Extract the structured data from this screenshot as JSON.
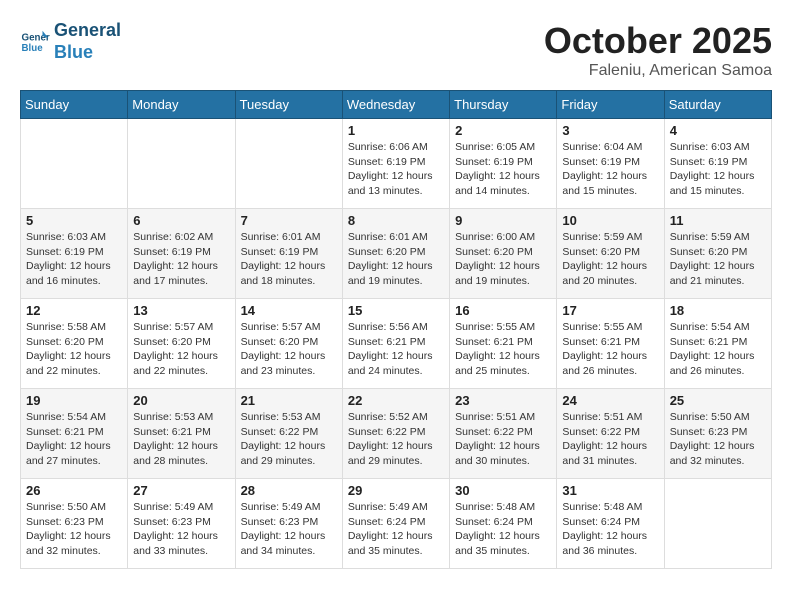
{
  "header": {
    "logo_line1": "General",
    "logo_line2": "Blue",
    "month": "October 2025",
    "location": "Faleniu, American Samoa"
  },
  "weekdays": [
    "Sunday",
    "Monday",
    "Tuesday",
    "Wednesday",
    "Thursday",
    "Friday",
    "Saturday"
  ],
  "weeks": [
    [
      {
        "day": "",
        "info": ""
      },
      {
        "day": "",
        "info": ""
      },
      {
        "day": "",
        "info": ""
      },
      {
        "day": "1",
        "info": "Sunrise: 6:06 AM\nSunset: 6:19 PM\nDaylight: 12 hours\nand 13 minutes."
      },
      {
        "day": "2",
        "info": "Sunrise: 6:05 AM\nSunset: 6:19 PM\nDaylight: 12 hours\nand 14 minutes."
      },
      {
        "day": "3",
        "info": "Sunrise: 6:04 AM\nSunset: 6:19 PM\nDaylight: 12 hours\nand 15 minutes."
      },
      {
        "day": "4",
        "info": "Sunrise: 6:03 AM\nSunset: 6:19 PM\nDaylight: 12 hours\nand 15 minutes."
      }
    ],
    [
      {
        "day": "5",
        "info": "Sunrise: 6:03 AM\nSunset: 6:19 PM\nDaylight: 12 hours\nand 16 minutes."
      },
      {
        "day": "6",
        "info": "Sunrise: 6:02 AM\nSunset: 6:19 PM\nDaylight: 12 hours\nand 17 minutes."
      },
      {
        "day": "7",
        "info": "Sunrise: 6:01 AM\nSunset: 6:19 PM\nDaylight: 12 hours\nand 18 minutes."
      },
      {
        "day": "8",
        "info": "Sunrise: 6:01 AM\nSunset: 6:20 PM\nDaylight: 12 hours\nand 19 minutes."
      },
      {
        "day": "9",
        "info": "Sunrise: 6:00 AM\nSunset: 6:20 PM\nDaylight: 12 hours\nand 19 minutes."
      },
      {
        "day": "10",
        "info": "Sunrise: 5:59 AM\nSunset: 6:20 PM\nDaylight: 12 hours\nand 20 minutes."
      },
      {
        "day": "11",
        "info": "Sunrise: 5:59 AM\nSunset: 6:20 PM\nDaylight: 12 hours\nand 21 minutes."
      }
    ],
    [
      {
        "day": "12",
        "info": "Sunrise: 5:58 AM\nSunset: 6:20 PM\nDaylight: 12 hours\nand 22 minutes."
      },
      {
        "day": "13",
        "info": "Sunrise: 5:57 AM\nSunset: 6:20 PM\nDaylight: 12 hours\nand 22 minutes."
      },
      {
        "day": "14",
        "info": "Sunrise: 5:57 AM\nSunset: 6:20 PM\nDaylight: 12 hours\nand 23 minutes."
      },
      {
        "day": "15",
        "info": "Sunrise: 5:56 AM\nSunset: 6:21 PM\nDaylight: 12 hours\nand 24 minutes."
      },
      {
        "day": "16",
        "info": "Sunrise: 5:55 AM\nSunset: 6:21 PM\nDaylight: 12 hours\nand 25 minutes."
      },
      {
        "day": "17",
        "info": "Sunrise: 5:55 AM\nSunset: 6:21 PM\nDaylight: 12 hours\nand 26 minutes."
      },
      {
        "day": "18",
        "info": "Sunrise: 5:54 AM\nSunset: 6:21 PM\nDaylight: 12 hours\nand 26 minutes."
      }
    ],
    [
      {
        "day": "19",
        "info": "Sunrise: 5:54 AM\nSunset: 6:21 PM\nDaylight: 12 hours\nand 27 minutes."
      },
      {
        "day": "20",
        "info": "Sunrise: 5:53 AM\nSunset: 6:21 PM\nDaylight: 12 hours\nand 28 minutes."
      },
      {
        "day": "21",
        "info": "Sunrise: 5:53 AM\nSunset: 6:22 PM\nDaylight: 12 hours\nand 29 minutes."
      },
      {
        "day": "22",
        "info": "Sunrise: 5:52 AM\nSunset: 6:22 PM\nDaylight: 12 hours\nand 29 minutes."
      },
      {
        "day": "23",
        "info": "Sunrise: 5:51 AM\nSunset: 6:22 PM\nDaylight: 12 hours\nand 30 minutes."
      },
      {
        "day": "24",
        "info": "Sunrise: 5:51 AM\nSunset: 6:22 PM\nDaylight: 12 hours\nand 31 minutes."
      },
      {
        "day": "25",
        "info": "Sunrise: 5:50 AM\nSunset: 6:23 PM\nDaylight: 12 hours\nand 32 minutes."
      }
    ],
    [
      {
        "day": "26",
        "info": "Sunrise: 5:50 AM\nSunset: 6:23 PM\nDaylight: 12 hours\nand 32 minutes."
      },
      {
        "day": "27",
        "info": "Sunrise: 5:49 AM\nSunset: 6:23 PM\nDaylight: 12 hours\nand 33 minutes."
      },
      {
        "day": "28",
        "info": "Sunrise: 5:49 AM\nSunset: 6:23 PM\nDaylight: 12 hours\nand 34 minutes."
      },
      {
        "day": "29",
        "info": "Sunrise: 5:49 AM\nSunset: 6:24 PM\nDaylight: 12 hours\nand 35 minutes."
      },
      {
        "day": "30",
        "info": "Sunrise: 5:48 AM\nSunset: 6:24 PM\nDaylight: 12 hours\nand 35 minutes."
      },
      {
        "day": "31",
        "info": "Sunrise: 5:48 AM\nSunset: 6:24 PM\nDaylight: 12 hours\nand 36 minutes."
      },
      {
        "day": "",
        "info": ""
      }
    ]
  ]
}
